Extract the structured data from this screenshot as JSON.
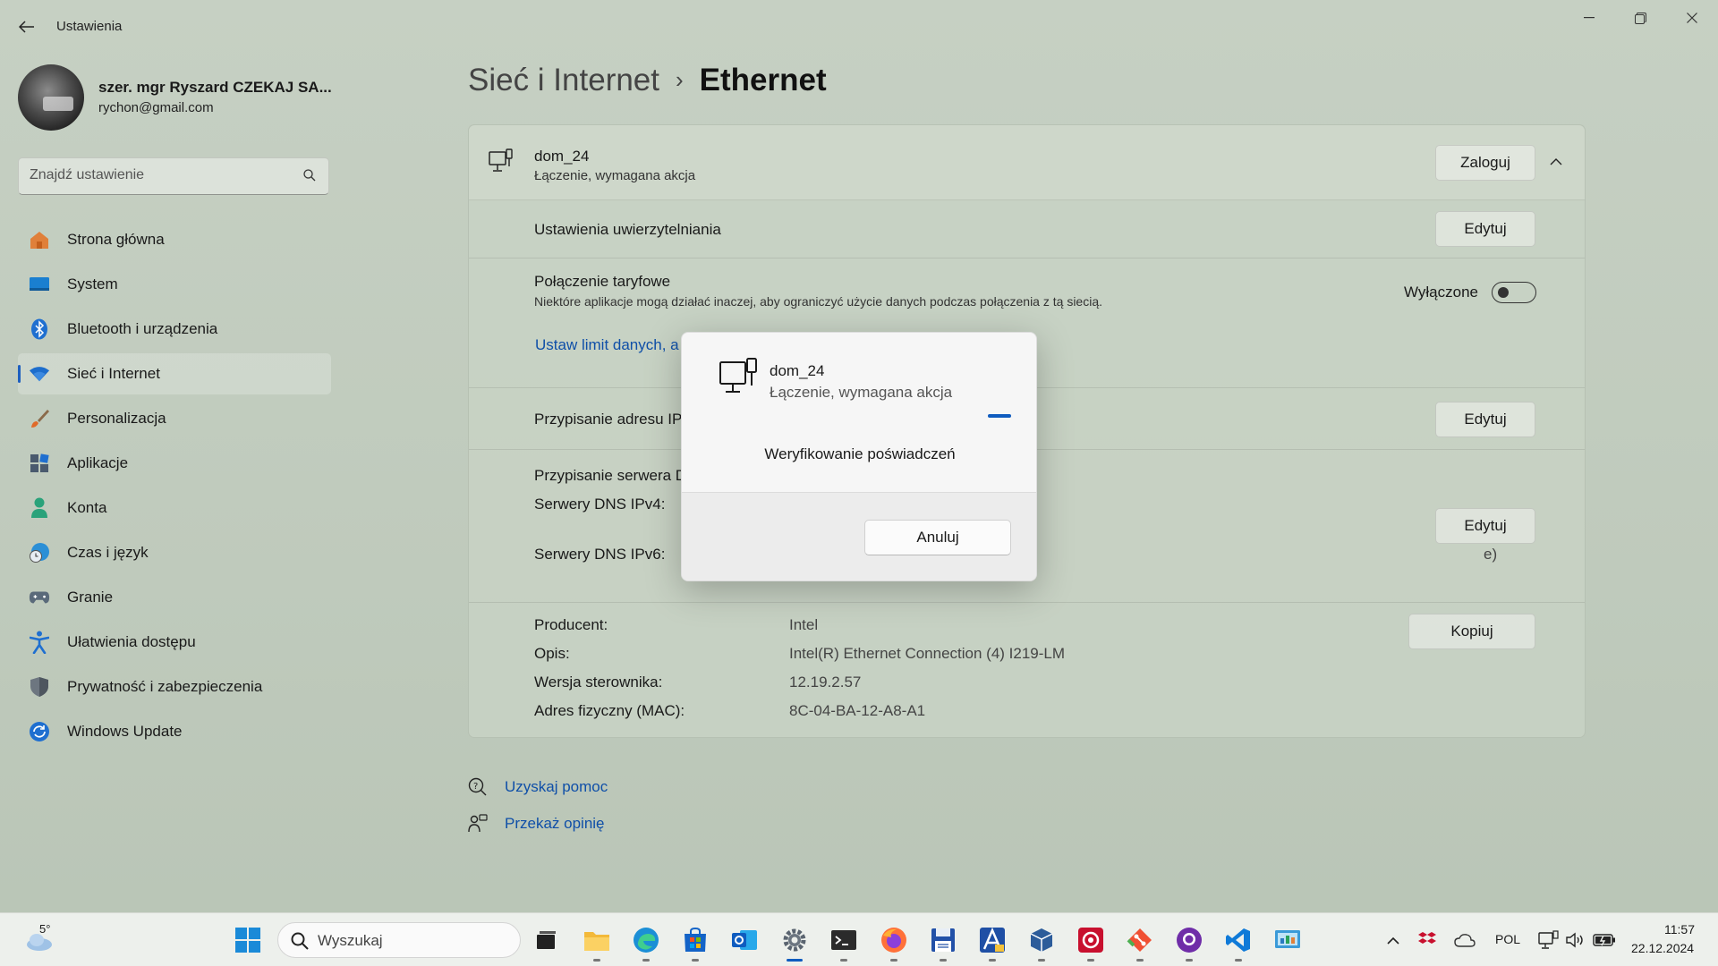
{
  "window": {
    "title": "Ustawienia",
    "controls": {
      "minimize": "—",
      "restore": "❐",
      "close": "✕"
    }
  },
  "profile": {
    "name": "szer. mgr Ryszard CZEKAJ SA...",
    "email": "rychon@gmail.com"
  },
  "search": {
    "placeholder": "Znajdź ustawienie"
  },
  "sidebar": {
    "items": [
      {
        "label": "Strona główna",
        "icon": "home-icon"
      },
      {
        "label": "System",
        "icon": "system-icon"
      },
      {
        "label": "Bluetooth i urządzenia",
        "icon": "bluetooth-icon"
      },
      {
        "label": "Sieć i Internet",
        "icon": "wifi-icon",
        "active": true
      },
      {
        "label": "Personalizacja",
        "icon": "brush-icon"
      },
      {
        "label": "Aplikacje",
        "icon": "apps-icon"
      },
      {
        "label": "Konta",
        "icon": "account-icon"
      },
      {
        "label": "Czas i język",
        "icon": "clock-globe-icon"
      },
      {
        "label": "Granie",
        "icon": "gamepad-icon"
      },
      {
        "label": "Ułatwienia dostępu",
        "icon": "accessibility-icon"
      },
      {
        "label": "Prywatność i zabezpieczenia",
        "icon": "shield-icon"
      },
      {
        "label": "Windows Update",
        "icon": "update-icon"
      }
    ]
  },
  "breadcrumb": {
    "parent": "Sieć i Internet",
    "separator": "›",
    "current": "Ethernet"
  },
  "connection": {
    "name": "dom_24",
    "status": "Łączenie, wymagana akcja",
    "login_button": "Zaloguj",
    "auth_settings": "Ustawienia uwierzytelniania",
    "auth_edit": "Edytuj",
    "metered_title": "Połączenie taryfowe",
    "metered_desc": "Niektóre aplikacje mogą działać inaczej, aby ograniczyć użycie danych podczas połączenia z tą siecią.",
    "metered_state": "Wyłączone",
    "data_limit_link": "Ustaw limit danych, a",
    "ip_assign": "Przypisanie adresu IP:",
    "ip_edit": "Edytuj",
    "dns_assign": "Przypisanie serwera D",
    "dns_ipv4": "Serwery DNS IPv4:",
    "dns_ipv6": "Serwery DNS IPv6:",
    "dns_ipv6_tail": "e)",
    "dns_edit": "Edytuj",
    "copy_button": "Kopiuj",
    "properties": [
      {
        "key": "Producent:",
        "value": "Intel"
      },
      {
        "key": "Opis:",
        "value": "Intel(R) Ethernet Connection (4) I219-LM"
      },
      {
        "key": "Wersja sterownika:",
        "value": "12.19.2.57"
      },
      {
        "key": "Adres fizyczny (MAC):",
        "value": "8C-04-BA-12-A8-A1"
      }
    ]
  },
  "help": {
    "get_help": "Uzyskaj pomoc",
    "feedback": "Przekaż opinię"
  },
  "dialog": {
    "name": "dom_24",
    "status": "Łączenie, wymagana akcja",
    "message": "Weryfikowanie poświadczeń",
    "cancel": "Anuluj"
  },
  "taskbar": {
    "weather_temp": "5°",
    "search_placeholder": "Wyszukaj",
    "language": "POL",
    "time": "11:57",
    "date": "22.12.2024",
    "apps": [
      "windows-start-icon",
      "task-view-icon",
      "file-explorer-icon",
      "edge-icon",
      "store-icon",
      "outlook-icon",
      "settings-icon",
      "terminal-icon",
      "firefox-icon",
      "floppy-save-icon",
      "autocad-icon",
      "virtualbox-icon",
      "app-icon",
      "git-icon",
      "github-icon",
      "vscode-icon",
      "control-panel-icon"
    ]
  },
  "colors": {
    "accent": "#0f5cbf",
    "link": "#0f4fa8",
    "background": "#c3ccc0"
  }
}
